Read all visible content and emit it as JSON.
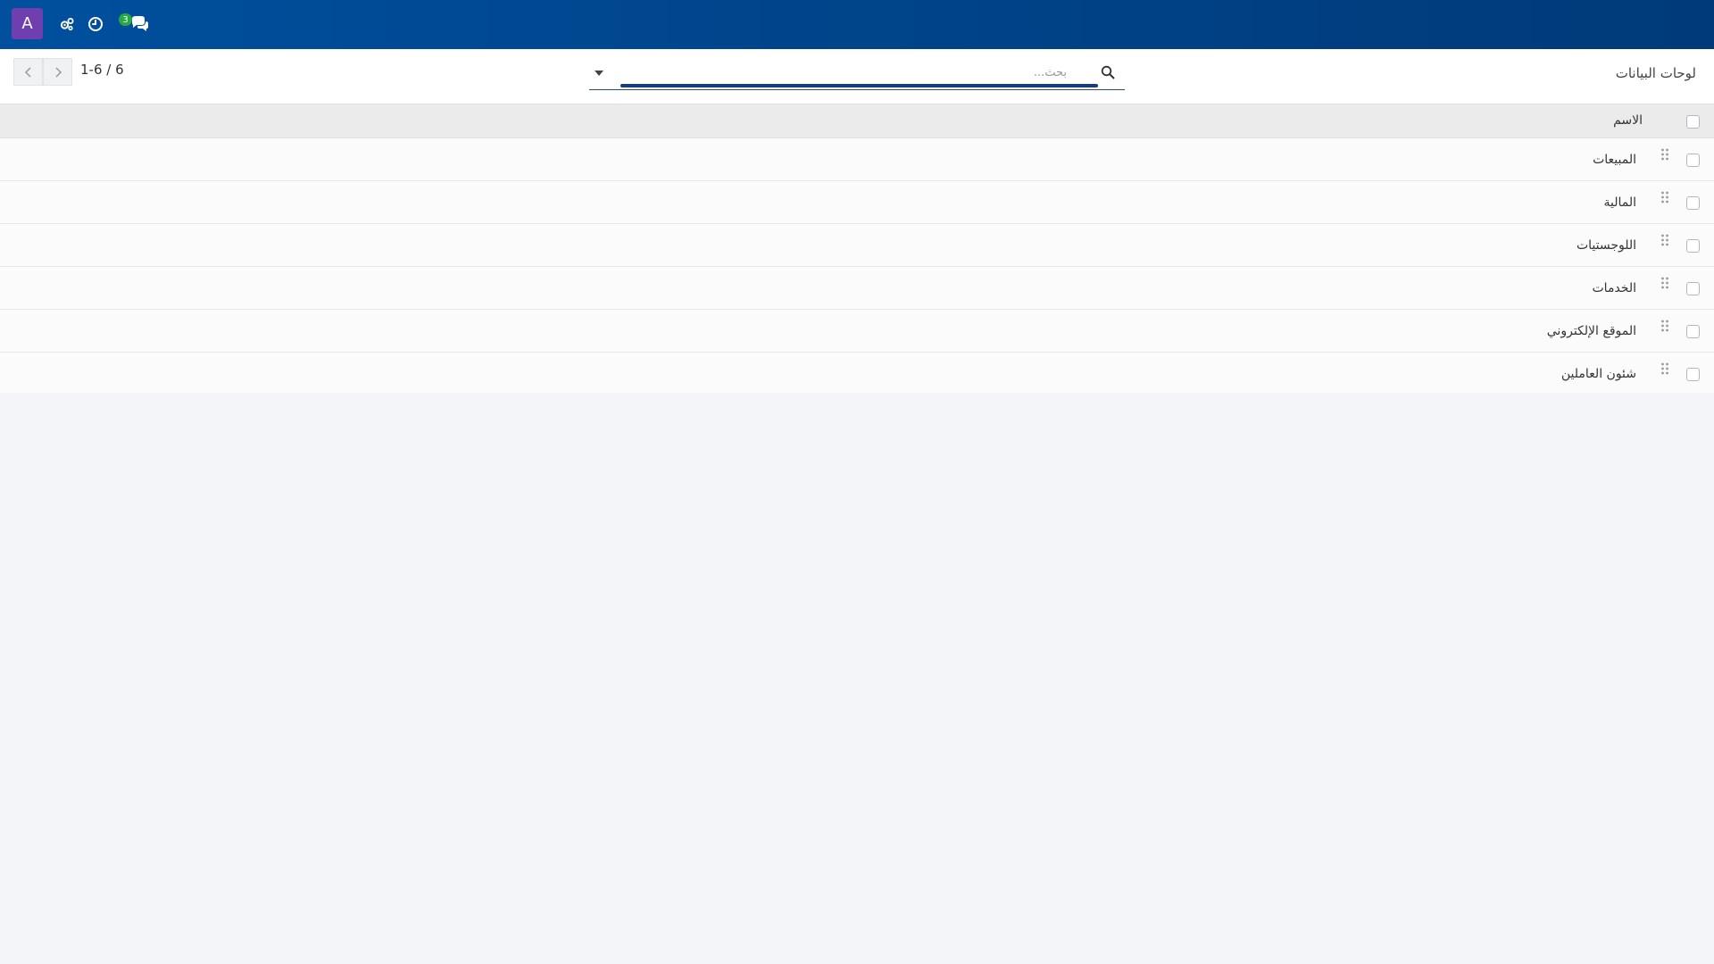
{
  "topbar": {
    "avatar_letter": "A",
    "icons": [
      "settings-cog-icon",
      "clock-icon",
      "chat-icon"
    ],
    "chat_badge": "3",
    "background": "#00509e"
  },
  "control": {
    "breadcrumb": "لوحات البيانات",
    "search_placeholder": "بحث...",
    "pager_value": "1-6 / 6",
    "pager_prev_icon": "chevron-left-icon",
    "pager_next_icon": "chevron-right-icon"
  },
  "list": {
    "header": {
      "name": "الاسم"
    },
    "rows": [
      {
        "name": "المبيعات"
      },
      {
        "name": "المالية"
      },
      {
        "name": "اللوجستيات"
      },
      {
        "name": "الخدمات"
      },
      {
        "name": "الموقع الإلكتروني"
      },
      {
        "name": "شئون العاملين"
      }
    ]
  },
  "colors": {
    "accent": "#133f7e",
    "avatar": "#6f3fb0",
    "badge": "#28a745"
  }
}
